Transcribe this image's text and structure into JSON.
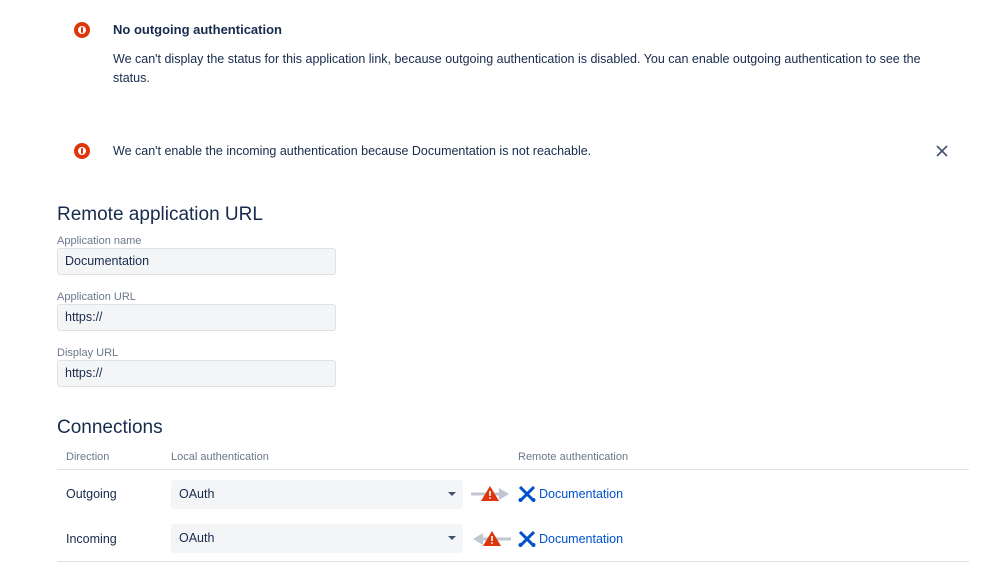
{
  "messages": {
    "outgoing": {
      "icon": "error-icon",
      "title": "No outgoing authentication",
      "body": "We can't display the status for this application link, because outgoing authentication is disabled. You can enable outgoing authentication to see the status."
    },
    "incoming": {
      "icon": "error-icon",
      "text": "We can't enable the incoming authentication because Documentation is not reachable.",
      "close_icon": "close-icon"
    }
  },
  "remote_app": {
    "heading": "Remote application URL",
    "fields": {
      "app_name": {
        "label": "Application name",
        "value": "Documentation"
      },
      "app_url": {
        "label": "Application URL",
        "value": "https://"
      },
      "display_url": {
        "label": "Display URL",
        "value": "https://"
      }
    }
  },
  "connections": {
    "heading": "Connections",
    "columns": {
      "direction": "Direction",
      "local": "Local authentication",
      "remote": "Remote authentication"
    },
    "rows": [
      {
        "direction": "Outgoing",
        "local": "OAuth",
        "arrow": "right-arrow-warning-icon",
        "remote": "Documentation",
        "remote_icon": "application-link-icon"
      },
      {
        "direction": "Incoming",
        "local": "OAuth",
        "arrow": "left-arrow-warning-icon",
        "remote": "Documentation",
        "remote_icon": "application-link-icon"
      }
    ]
  },
  "colors": {
    "error": "#de350b",
    "link": "#0052cc",
    "text": "#172b4d",
    "muted": "#6b778c"
  }
}
